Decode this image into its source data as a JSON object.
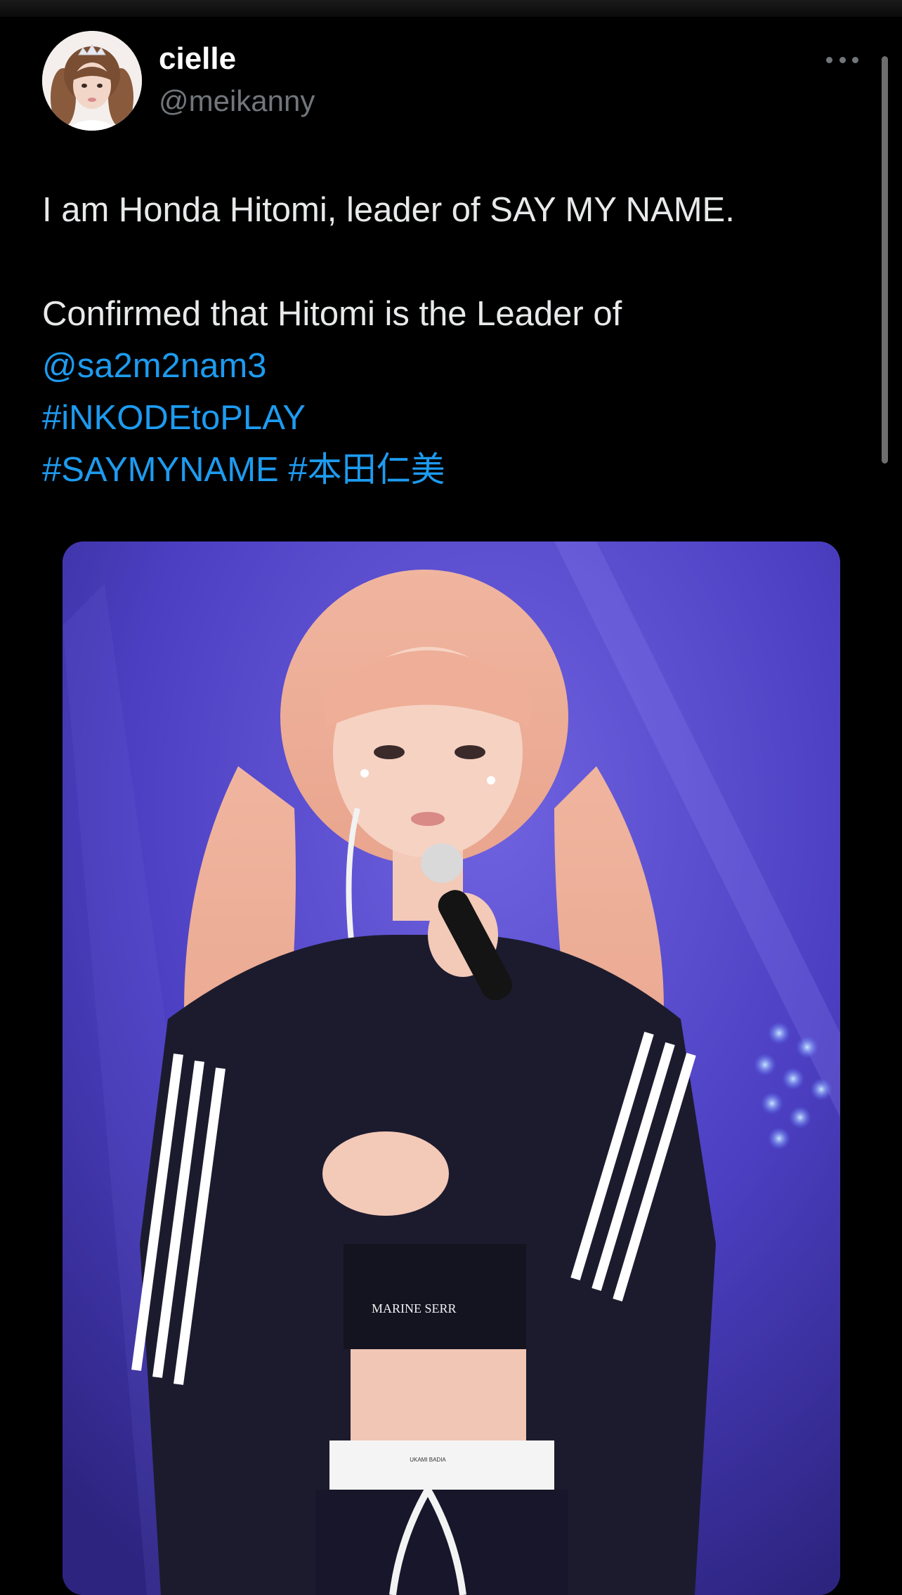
{
  "author": {
    "display_name": "cielle",
    "handle": "@meikanny"
  },
  "tweet": {
    "line1": "I am Honda Hitomi, leader of SAY MY NAME.",
    "line2": "Confirmed that Hitomi is the Leader of",
    "mention": "@sa2m2nam3",
    "hashtag1": "#iNKODEtoPLAY",
    "hashtag2": "#SAYMYNAME",
    "hashtag3": "#本田仁美"
  },
  "media": {
    "shirt_text": "MARINE SERR",
    "waistband_text": "UKAMI BADIA"
  },
  "icons": {
    "more": "more-horizontal-icon"
  },
  "colors": {
    "background": "#000000",
    "link": "#1d9bf0",
    "secondary_text": "#71767b",
    "primary_text": "#e7e9ea"
  }
}
